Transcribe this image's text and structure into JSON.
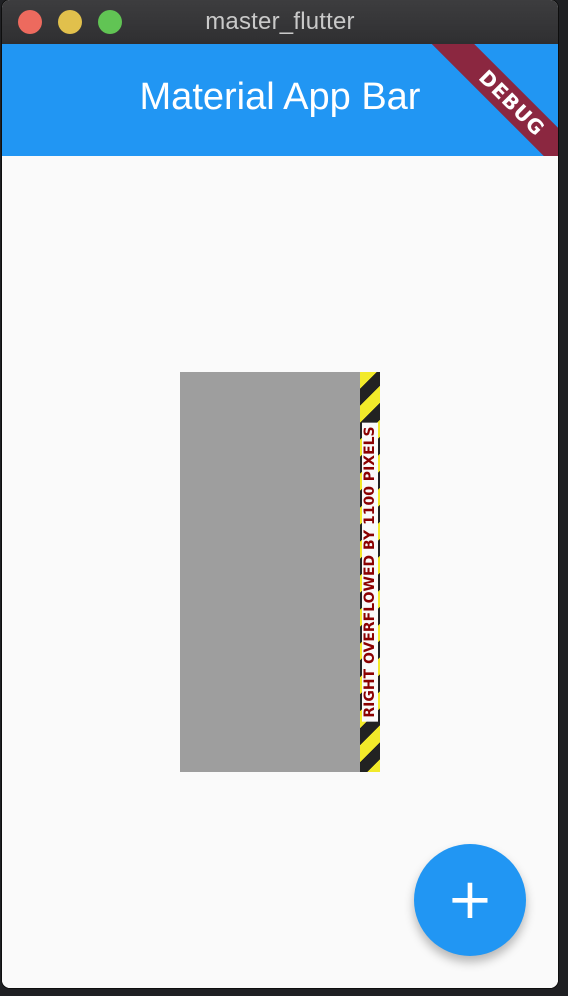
{
  "window": {
    "title": "master_flutter"
  },
  "appbar": {
    "title": "Material App Bar",
    "color": "#2196f3"
  },
  "debug_banner": {
    "label": "DEBUG",
    "color": "#8b2740"
  },
  "overflow": {
    "message": "RIGHT OVERFLOWED BY 1100 PIXELS",
    "stripe_colors": [
      "#f2ea2a",
      "#222222"
    ],
    "text_color": "#8b0000"
  },
  "fab": {
    "icon": "add-icon",
    "glyph": "+",
    "color": "#2196f3"
  },
  "colors": {
    "background": "#fafafa",
    "grey_box": "#9e9e9e",
    "titlebar": "#353537"
  }
}
